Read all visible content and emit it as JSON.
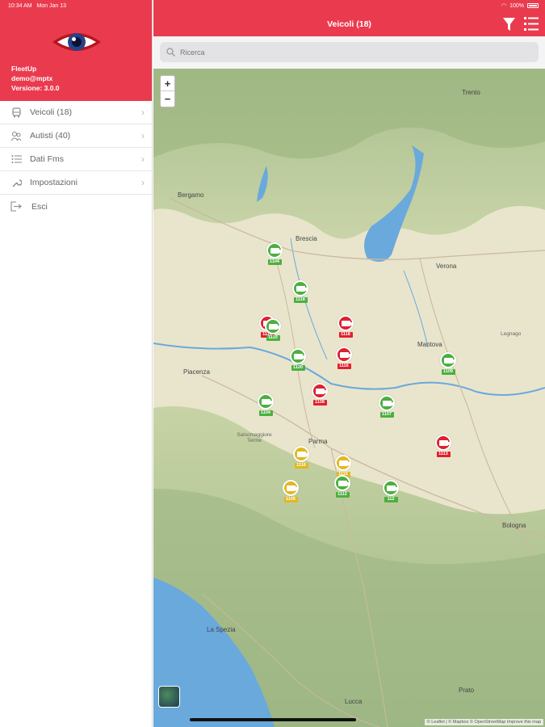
{
  "status": {
    "time": "10:34 AM",
    "date": "Mon Jan 13",
    "battery": "100%"
  },
  "sidebar": {
    "app_name": "FleetUp",
    "user": "demo@mptx",
    "version": "Versione: 3.0.0",
    "items": [
      {
        "label": "Veicoli (18)",
        "icon": "bus-icon"
      },
      {
        "label": "Autisti (40)",
        "icon": "people-icon"
      },
      {
        "label": "Dati Fms",
        "icon": "list-icon"
      },
      {
        "label": "Impostazioni",
        "icon": "wrench-icon"
      },
      {
        "label": "Esci",
        "icon": "logout-icon"
      }
    ]
  },
  "topbar": {
    "title": "Veicoli (18)",
    "filter_icon": "filter-icon",
    "list_icon": "list-view-icon"
  },
  "search": {
    "placeholder": "Ricerca"
  },
  "colors": {
    "brand": "#ea3b4e",
    "moving": "#4caf3f",
    "stopped": "#e0202e",
    "idle": "#e2b81e",
    "water": "#68a8dc"
  },
  "map": {
    "zoom_in": "+",
    "zoom_out": "−",
    "attribution": "© Leaflet | © Mapbox © OpenStreetMap Improve this map",
    "cities": {
      "trento": "Trento",
      "bergamo": "Bergamo",
      "brescia": "Brescia",
      "verona": "Verona",
      "mantova": "Mantova",
      "legnago": "Legnago",
      "piacenza": "Piacenza",
      "salsomaggiore": "Salsomaggiore Terme",
      "parma": "Parma",
      "bologna": "Bologna",
      "prato": "Prato",
      "laspezia": "La Spezia",
      "lucca": "Lucca"
    },
    "markers": [
      {
        "id": "1104",
        "status": "green"
      },
      {
        "id": "1118",
        "status": "green"
      },
      {
        "id": "1119",
        "status": "red"
      },
      {
        "id": "1110",
        "status": "green"
      },
      {
        "id": "1118",
        "status": "red"
      },
      {
        "id": "1120",
        "status": "green"
      },
      {
        "id": "1116",
        "status": "red"
      },
      {
        "id": "1109",
        "status": "green"
      },
      {
        "id": "1108",
        "status": "red"
      },
      {
        "id": "1104",
        "status": "green"
      },
      {
        "id": "1107",
        "status": "green"
      },
      {
        "id": "1113",
        "status": "red"
      },
      {
        "id": "1116",
        "status": "yellow"
      },
      {
        "id": "1115",
        "status": "yellow"
      },
      {
        "id": "1105",
        "status": "yellow"
      },
      {
        "id": "1112",
        "status": "green"
      },
      {
        "id": "112",
        "status": "green"
      }
    ]
  }
}
